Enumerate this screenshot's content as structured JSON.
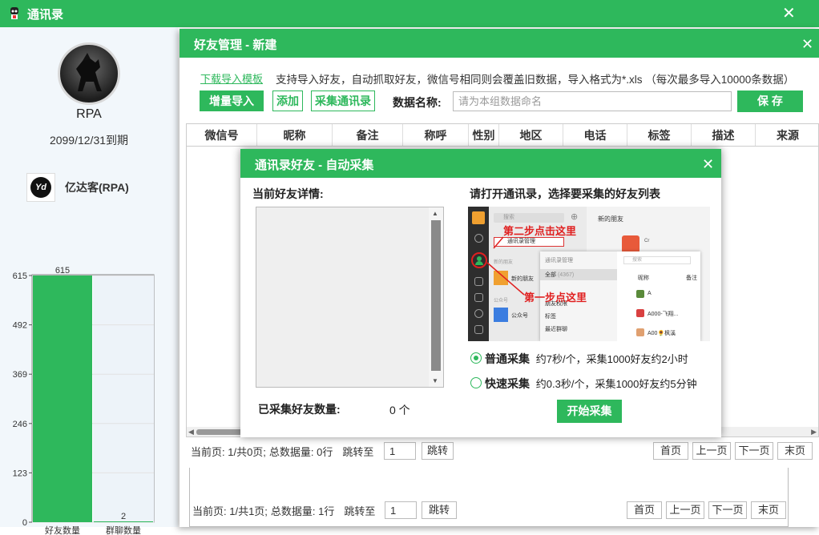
{
  "main_window": {
    "title": "通讯录"
  },
  "profile": {
    "name": "RPA",
    "expiry": "2099/12/31到期",
    "brand_logo_text": "Yd",
    "brand_name": "亿达客(RPA)"
  },
  "chart_data": {
    "type": "bar",
    "categories": [
      "好友数量",
      "群聊数量"
    ],
    "values": [
      615,
      2
    ],
    "ylim": [
      0,
      615
    ],
    "yticks": [
      0,
      123,
      246,
      369,
      492,
      615
    ],
    "bar_color": "#2eb85c",
    "grid": true
  },
  "friend_manager": {
    "title": "好友管理 - 新建",
    "download_template": "下载导入模板",
    "info_text": "支持导入好友，自动抓取好友，微信号相同则会覆盖旧数据，导入格式为*.xls （每次最多导入10000条数据）",
    "btn_incremental_import": "增量导入",
    "btn_add": "添加",
    "btn_collect": "采集通讯录",
    "data_name_label": "数据名称:",
    "data_name_placeholder": "请为本组数据命名",
    "btn_save": "保 存",
    "columns": [
      "微信号",
      "昵称",
      "备注",
      "称呼",
      "性别",
      "地区",
      "电话",
      "标签",
      "描述",
      "来源"
    ],
    "pager": {
      "current": "当前页: 1/共0页;",
      "total": "总数据量: 0行",
      "jump_label": "跳转至",
      "page_input": "1",
      "jump_btn": "跳转",
      "first": "首页",
      "prev": "上一页",
      "next": "下一页",
      "last": "末页"
    }
  },
  "back_pager": {
    "current": "当前页: 1/共1页;",
    "total": "总数据量: 1行",
    "jump_label": "跳转至",
    "page_input": "1",
    "jump_btn": "跳转",
    "first": "首页",
    "prev": "上一页",
    "next": "下一页",
    "last": "末页"
  },
  "auto_collect": {
    "title": "通讯录好友 - 自动采集",
    "current_detail_label": "当前好友详情:",
    "instruction": "请打开通讯录，选择要采集的好友列表",
    "collected_label": "已采集好友数量:",
    "collected_count": "0 个",
    "mode_normal_label": "普通采集",
    "mode_normal_desc": "约7秒/个，采集1000好友约2小时",
    "mode_fast_label": "快速采集",
    "mode_fast_desc": "约0.3秒/个，采集1000好友约5分钟",
    "selected_mode": "normal",
    "btn_start": "开始采集",
    "screenshot": {
      "search": "搜索",
      "new_friends_header": "新的朋友",
      "step2": "第二步点击这里",
      "step1": "第一步点这里",
      "contacts_manage_btn": "通讯录管理",
      "new_friends_list": "新的朋友",
      "new_friends_count": "4367",
      "public_account_header": "公众号",
      "public_account": "公众号",
      "manage_panel_title": "通讯录管理",
      "menu_all": "全部",
      "menu_all_count": "(4367)",
      "menu_permissions": "朋友权限",
      "menu_tags": "标签",
      "menu_recent_groups": "最近群聊",
      "col_nickname": "昵称",
      "col_remark": "备注",
      "rows": [
        "A",
        "A000-飞翔...",
        "A00🌻枫溪"
      ],
      "cr_label": "Cr",
      "search_inner": "搜索"
    }
  }
}
